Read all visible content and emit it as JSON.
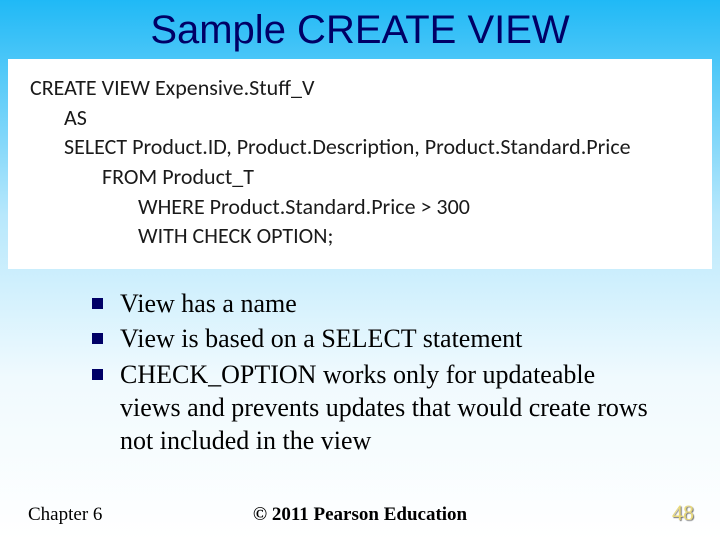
{
  "title": "Sample CREATE VIEW",
  "code": {
    "l1": "CREATE VIEW Expensive.Stuff_V",
    "l2": "AS",
    "l3": "SELECT Product.ID, Product.Description, Product.Standard.Price",
    "l4": "FROM Product_T",
    "l5": "WHERE Product.Standard.Price > 300",
    "l6": "WITH CHECK OPTION;"
  },
  "bullets": {
    "b1": "View has a name",
    "b2": "View is based on a SELECT statement",
    "b3": "CHECK_OPTION works only for updateable views and prevents updates that would create rows not included in the view"
  },
  "footer": {
    "chapter": "Chapter 6",
    "copyright": "© 2011 Pearson Education",
    "pagenum": "48"
  }
}
